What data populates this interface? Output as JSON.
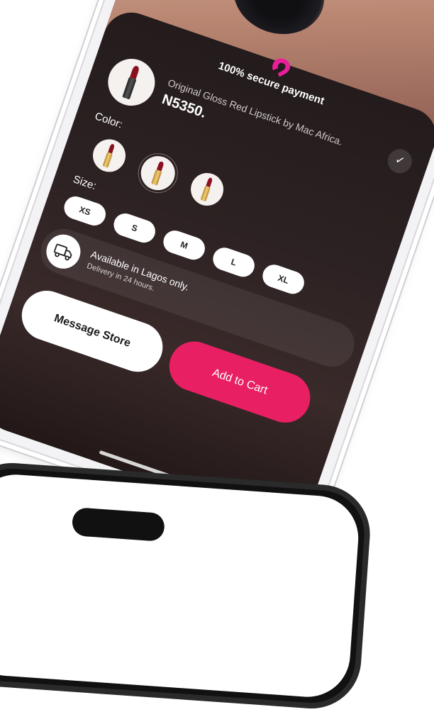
{
  "header": {
    "secure_text": "100% secure payment"
  },
  "product": {
    "name": "Original Gloss Red Lipstick by Mac Africa.",
    "price": "N5350."
  },
  "options": {
    "color_label": "Color:",
    "size_label": "Size:",
    "sizes": [
      "XS",
      "S",
      "M",
      "L",
      "XL"
    ]
  },
  "delivery": {
    "line1": "Available in Lagos only.",
    "line2": "Delivery in 24 hours."
  },
  "actions": {
    "message_label": "Message Store",
    "cart_label": "Add to Cart"
  },
  "colors": {
    "accent": "#e91f63",
    "sheet": "#2a1b1c",
    "logo": "#e91f9a"
  }
}
